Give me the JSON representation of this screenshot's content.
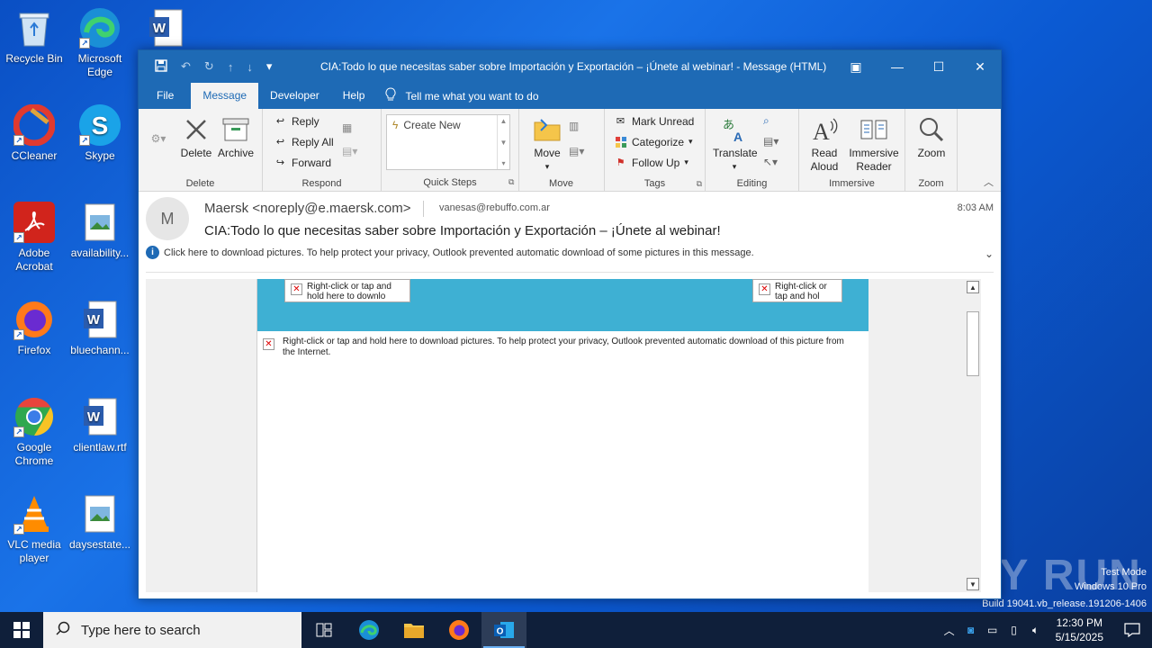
{
  "desktop": {
    "icons": [
      {
        "label": "Recycle Bin"
      },
      {
        "label": "Microsoft Edge"
      },
      {
        "label": ""
      },
      {
        "label": "CCleaner"
      },
      {
        "label": "Skype"
      },
      {
        "label": "Adobe Acrobat"
      },
      {
        "label": "availability..."
      },
      {
        "label": "Firefox"
      },
      {
        "label": "bluechann..."
      },
      {
        "label": "Google Chrome"
      },
      {
        "label": "clientlaw.rtf"
      },
      {
        "label": "VLC media player"
      },
      {
        "label": "daysestate..."
      }
    ]
  },
  "window": {
    "title": "CIA:Todo lo que necesitas saber sobre Importación y Exportación – ¡Únete al webinar!  -  Message (HTML)",
    "tabs": [
      "File",
      "Message",
      "Developer",
      "Help"
    ],
    "tell_me": "Tell me what you want to do"
  },
  "ribbon": {
    "delete": {
      "delete": "Delete",
      "archive": "Archive",
      "label": "Delete"
    },
    "respond": {
      "reply": "Reply",
      "reply_all": "Reply All",
      "forward": "Forward",
      "label": "Respond"
    },
    "quick_steps": {
      "create_new": "Create New",
      "label": "Quick Steps"
    },
    "move": {
      "move": "Move",
      "label": "Move"
    },
    "tags": {
      "mark_unread": "Mark Unread",
      "categorize": "Categorize",
      "follow_up": "Follow Up",
      "label": "Tags"
    },
    "editing": {
      "translate": "Translate",
      "label": "Editing"
    },
    "immersive": {
      "read_aloud_1": "Read",
      "read_aloud_2": "Aloud",
      "immersive_reader_1": "Immersive",
      "immersive_reader_2": "Reader",
      "label": "Immersive"
    },
    "zoom": {
      "zoom": "Zoom",
      "label": "Zoom"
    }
  },
  "message": {
    "avatar_initial": "M",
    "from": "Maersk <noreply@e.maersk.com>",
    "to": "vanesas@rebuffo.com.ar",
    "time": "8:03 AM",
    "subject": "CIA:Todo lo que necesitas saber sobre Importación y Exportación – ¡Únete al webinar!",
    "info_bar": "Click here to download pictures. To help protect your privacy, Outlook prevented automatic download of some pictures in this message.",
    "placeholder_left": "Right-click or tap and hold here to downlo",
    "placeholder_right": "Right-click or tap and hol",
    "placeholder_main": "Right-click or tap and hold here to download pictures. To help protect your privacy, Outlook prevented automatic download of this picture from the Internet."
  },
  "watermark": {
    "line1": "Test Mode",
    "line2": "Windows 10 Pro",
    "line3": "Build 19041.vb_release.191206-1406",
    "logo": "ANY RUN"
  },
  "taskbar": {
    "search_placeholder": "Type here to search",
    "time": "12:30 PM",
    "date": "5/15/2025"
  }
}
